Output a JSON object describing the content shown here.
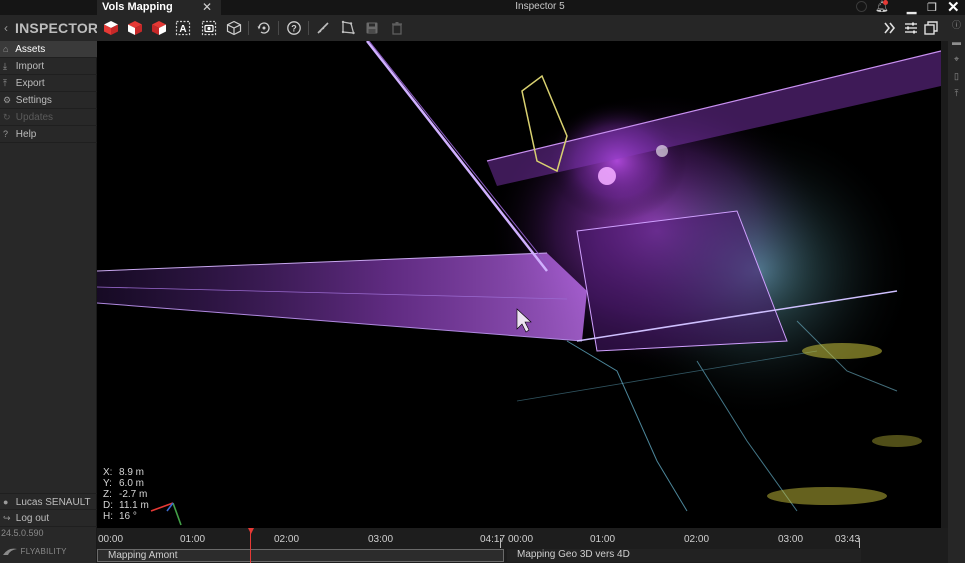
{
  "app": {
    "brand": "INSPECTOR",
    "window_title": "Inspector 5",
    "tab": {
      "label": "Vols Mapping"
    }
  },
  "sidebar": {
    "items": [
      {
        "label": "Assets",
        "icon": "home-icon",
        "state": "active"
      },
      {
        "label": "Import",
        "icon": "download-icon",
        "state": "normal"
      },
      {
        "label": "Export",
        "icon": "upload-icon",
        "state": "normal"
      },
      {
        "label": "Settings",
        "icon": "gear-icon",
        "state": "normal"
      },
      {
        "label": "Updates",
        "icon": "refresh-icon",
        "state": "disabled"
      },
      {
        "label": "Help",
        "icon": "help-icon",
        "state": "normal"
      }
    ],
    "user": "Lucas SENAULT",
    "logout": "Log out",
    "version": "24.5.0.590",
    "company": "FLYABILITY"
  },
  "toolbar": {
    "tools": [
      "cube-solid-icon",
      "cube-side-icon",
      "cube-top-icon",
      "text-box-icon",
      "camera-icon",
      "cube-wireframe-icon",
      "rotate-view-icon",
      "help-circle-icon",
      "ruler-icon",
      "polygon-icon",
      "save-icon",
      "trash-icon"
    ],
    "right_tools": [
      "double-chevron-right-icon",
      "sliders-icon",
      "windows-icon"
    ]
  },
  "viewport": {
    "coords": [
      {
        "k": "X:",
        "v": "8.9 m"
      },
      {
        "k": "Y:",
        "v": "6.0 m"
      },
      {
        "k": "Z:",
        "v": "-2.7 m"
      },
      {
        "k": "D:",
        "v": "11.1 m"
      },
      {
        "k": "H:",
        "v": "16 °"
      }
    ]
  },
  "timeline": {
    "tracks": [
      {
        "name": "Mapping Amont",
        "ticks": [
          "00:00",
          "01:00",
          "02:00",
          "03:00",
          "04:17"
        ]
      },
      {
        "name": "Mapping Geo 3D vers 4D",
        "ticks": [
          "00:00",
          "01:00",
          "02:00",
          "03:00",
          "03:43"
        ]
      }
    ]
  },
  "colors": {
    "accent_red": "#e53935",
    "point_violet": "#b040e0",
    "point_cyan": "#6fc6d8",
    "point_yellow": "#c9c23c"
  }
}
